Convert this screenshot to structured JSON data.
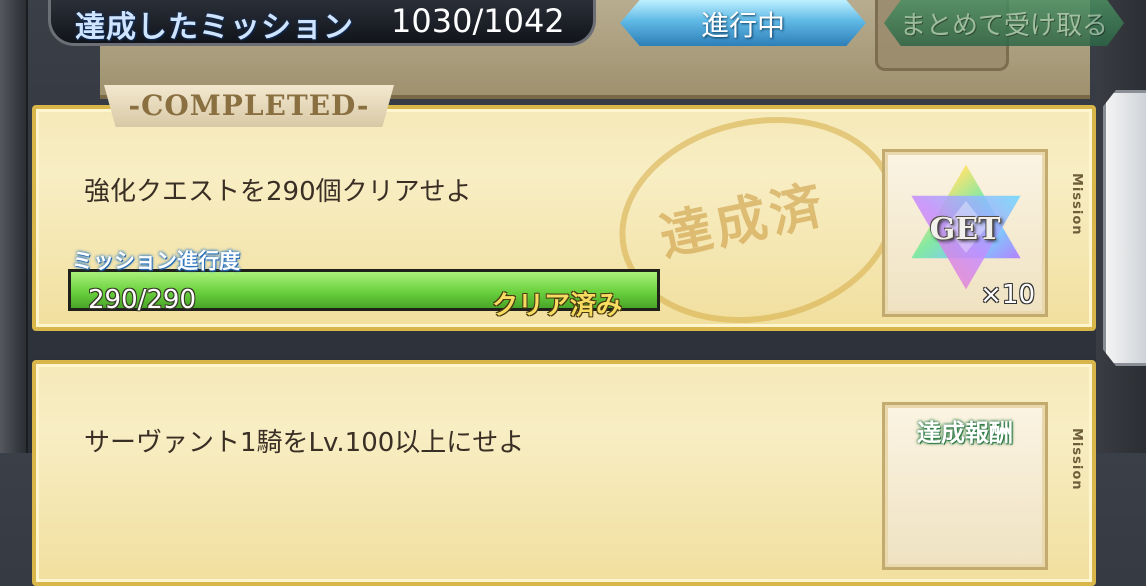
{
  "header": {
    "completed_label": "達成したミッション",
    "completed_count": "1030/1042",
    "tab_in_progress": "進行中",
    "collect_all_label": "まとめて受け取る"
  },
  "missions": [
    {
      "ribbon": "-COMPLETED-",
      "title": "強化クエストを290個クリアせよ",
      "stamp": "達成済",
      "progress_label": "ミッション進行度",
      "progress_text": "290/290",
      "progress_fraction": 1.0,
      "status": "クリア済み",
      "reward_get": "GET",
      "reward_qty": "×10",
      "side_tag": "Mission",
      "reward_icon": "rainbow-star-icon"
    },
    {
      "title": "サーヴァント1騎をLv.100以上にせよ",
      "reward_label": "達成報酬",
      "side_tag": "Mission",
      "reward_icon": "rainbow-star-icon"
    }
  ],
  "colors": {
    "progress_fill": "#6ad13e",
    "card_border": "#d8b649",
    "tab_active": "#5fb9e6",
    "collect_button": "#2d6646"
  }
}
